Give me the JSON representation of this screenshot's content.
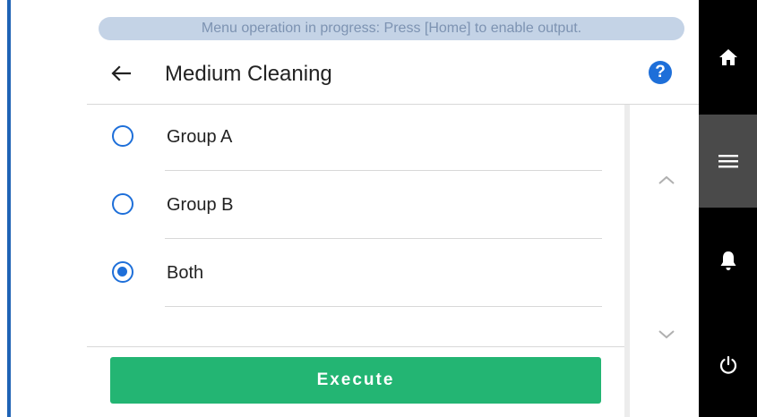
{
  "status_banner": "Menu operation in progress: Press [Home] to enable output.",
  "header": {
    "title": "Medium Cleaning",
    "back_icon": "arrow-left-icon",
    "help_icon": "question-mark-icon",
    "help_label": "?"
  },
  "options": [
    {
      "label": "Group A",
      "selected": false
    },
    {
      "label": "Group B",
      "selected": false
    },
    {
      "label": "Both",
      "selected": true
    }
  ],
  "execute_label": "Execute",
  "scroll": {
    "up_icon": "chevron-up-icon",
    "down_icon": "chevron-down-icon"
  },
  "sidebar": {
    "items": [
      {
        "icon": "home-icon",
        "active": false
      },
      {
        "icon": "menu-icon",
        "active": true
      },
      {
        "icon": "bell-icon",
        "active": false
      },
      {
        "icon": "power-icon",
        "active": false
      }
    ]
  },
  "colors": {
    "accent_blue": "#1e6fd9",
    "execute_green": "#23b573",
    "banner_bg": "#c4d3e6",
    "banner_text": "#7d93b2",
    "sidebar_bg": "#000000",
    "sidebar_active": "#4a4a4a"
  }
}
